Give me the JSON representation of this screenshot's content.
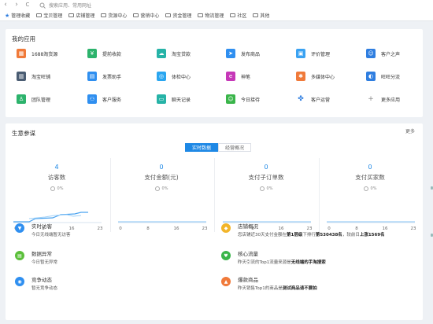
{
  "browser": {
    "back": "‹",
    "forward": "›",
    "reload": "C",
    "search_placeholder": "搜索应用、常用网址"
  },
  "bookmarks": [
    "管理收藏",
    "宝贝管理",
    "店铺管理",
    "货源中心",
    "营销中心",
    "资金管理",
    "物流管理",
    "社区",
    "其他"
  ],
  "my_apps": {
    "title": "我的应用",
    "items": [
      {
        "label": "1688淘货源",
        "color": "#f07a3a",
        "glyph": "▦"
      },
      {
        "label": "提前收款",
        "color": "#2cb36c",
        "glyph": "¥"
      },
      {
        "label": "淘宝贷款",
        "color": "#26b3a7",
        "glyph": "☁"
      },
      {
        "label": "发布商品",
        "color": "#2f8ff0",
        "glyph": "➤"
      },
      {
        "label": "评价管理",
        "color": "#3aa2f2",
        "glyph": "▣"
      },
      {
        "label": "客户之声",
        "color": "#2f7ee0",
        "glyph": "☺"
      },
      {
        "label": "淘宝旺铺",
        "color": "#4b5d73",
        "glyph": "▥"
      },
      {
        "label": "发票助手",
        "color": "#2f8ff0",
        "glyph": "▤"
      },
      {
        "label": "体检中心",
        "color": "#2aa6f0",
        "glyph": "◎"
      },
      {
        "label": "神笔",
        "color": "#c638b8",
        "glyph": "e"
      },
      {
        "label": "多媒体中心",
        "color": "#f07a3a",
        "glyph": "✱"
      },
      {
        "label": "旺旺分流",
        "color": "#2f7ee0",
        "glyph": "◐"
      },
      {
        "label": "团队管理",
        "color": "#2cb36c",
        "glyph": "♙"
      },
      {
        "label": "客户服务",
        "color": "#2f8ff0",
        "glyph": "⚇"
      },
      {
        "label": "聊天记录",
        "color": "#26b3a7",
        "glyph": "▭"
      },
      {
        "label": "今日接待",
        "color": "#3ab54a",
        "glyph": "☺"
      },
      {
        "label": "客户运营",
        "color": "#ffffff",
        "glyph": "✤"
      },
      {
        "label": "更多应用",
        "color": "#ffffff",
        "glyph": "+"
      }
    ]
  },
  "insights": {
    "title": "生意参谋",
    "more": "更多",
    "tabs": [
      "实时数据",
      "经营概况"
    ],
    "active_tab": 0,
    "metrics": [
      {
        "value": "4",
        "name": "访客数",
        "pct": "0%"
      },
      {
        "value": "0",
        "name": "支付金额(元)",
        "pct": "0%"
      },
      {
        "value": "0",
        "name": "支付子订单数",
        "pct": "0%"
      },
      {
        "value": "0",
        "name": "支付买家数",
        "pct": "0%"
      }
    ],
    "axis_ticks": [
      "0",
      "8",
      "16",
      "23"
    ]
  },
  "alerts": [
    {
      "title": "实时访客",
      "desc": "今日无线端暂无访客",
      "color": "#2f8ff0",
      "glyph": "▼"
    },
    {
      "title": "店铺概况",
      "desc_parts": [
        "您店铺近30天支付金额在",
        "第1层级",
        "下排行",
        "第530438名",
        "，较前日",
        "上涨1569名"
      ],
      "color": "#f2b52a",
      "glyph": "◆"
    },
    {
      "title": "数据异常",
      "desc": "今日暂无异常",
      "color": "#5bbf3a",
      "glyph": "▤"
    },
    {
      "title": "核心流量",
      "desc_parts": [
        "昨天引流的Top1流量来源是",
        "无线端的手淘搜索"
      ],
      "color": "#3ab54a",
      "glyph": "♥"
    },
    {
      "title": "竞争动态",
      "desc": "暂无竞争动态",
      "color": "#2f8ff0",
      "glyph": "◉"
    },
    {
      "title": "爆款商品",
      "desc_parts": [
        "昨天销售Top1的商品是",
        "测试商品请不要拍"
      ],
      "color": "#f07a3a",
      "glyph": "▲"
    }
  ]
}
